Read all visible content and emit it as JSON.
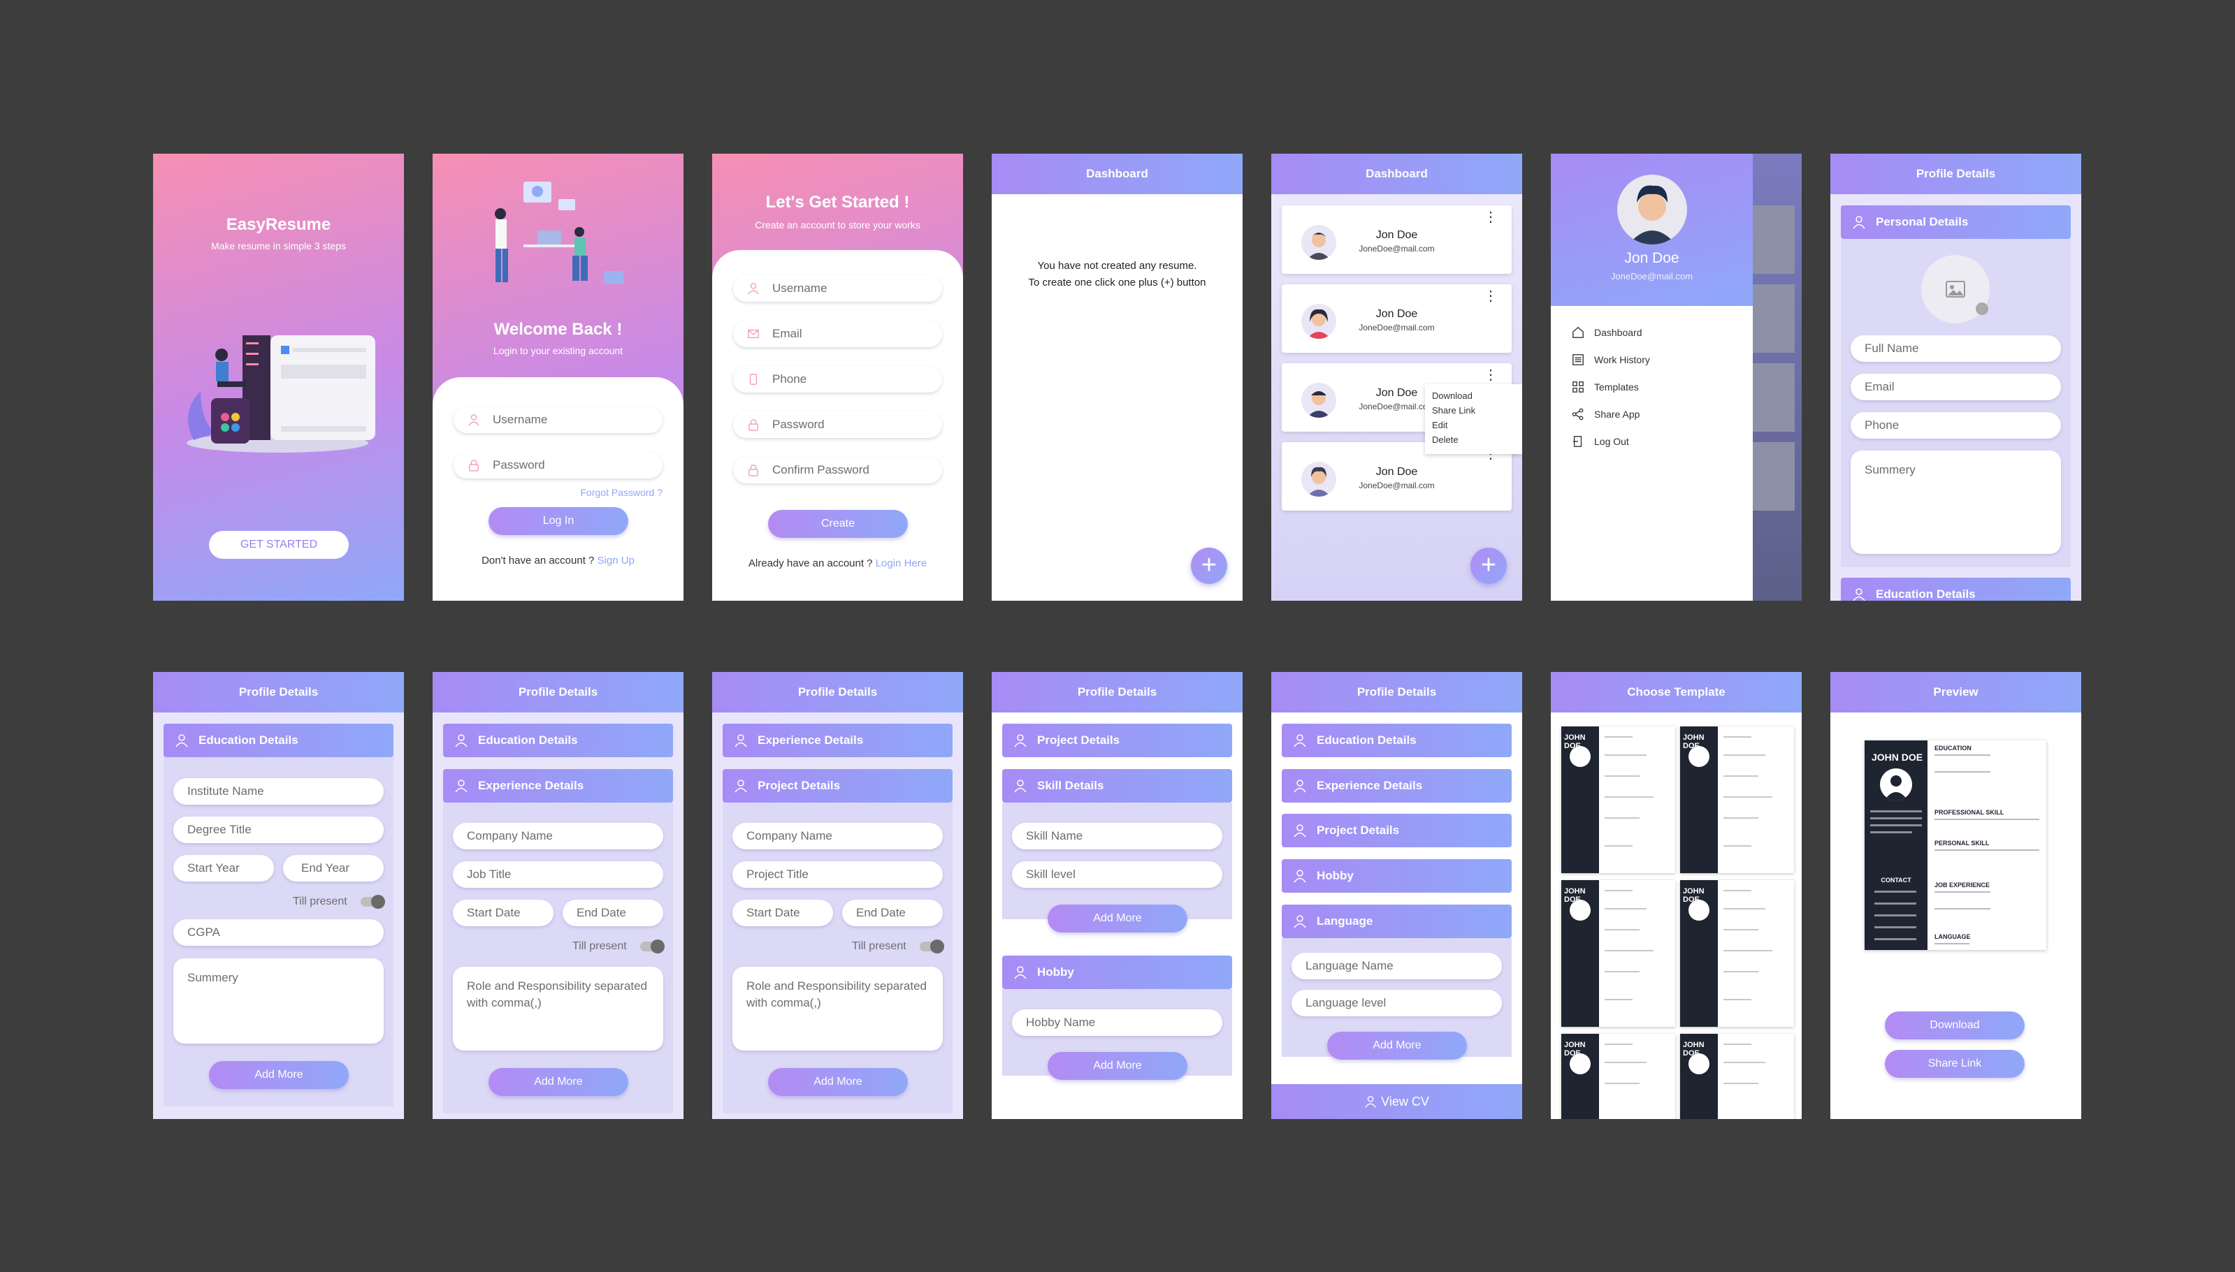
{
  "splash": {
    "title": "EasyResume",
    "subtitle": "Make resume in simple 3 steps",
    "button": "GET STARTED"
  },
  "login": {
    "title": "Welcome Back !",
    "subtitle": "Login to your existing account",
    "username_ph": "Username",
    "password_ph": "Password",
    "forgot": "Forgot Password ?",
    "button": "Log In",
    "signup_prompt": "Don't have an account ?",
    "signup_link": "Sign Up"
  },
  "register": {
    "title": "Let's Get Started !",
    "subtitle": "Create an account  to store  your works",
    "fields": [
      "Username",
      "Email",
      "Phone",
      "Password",
      "Confirm Password"
    ],
    "button": "Create",
    "login_prompt": "Already have an account ?",
    "login_link": "Login Here"
  },
  "dashboard_empty": {
    "title": "Dashboard",
    "line1": "You have not created any resume.",
    "line2": "To create one click one plus (+) button",
    "fab": "+"
  },
  "dashboard": {
    "title": "Dashboard",
    "cards": [
      {
        "name": "Jon Doe",
        "email": "JoneDoe@mail.com"
      },
      {
        "name": "Jon Doe",
        "email": "JoneDoe@mail.com"
      },
      {
        "name": "Jon Doe",
        "email": "JoneDoe@mail.com"
      },
      {
        "name": "Jon Doe",
        "email": "JoneDoe@mail.com"
      }
    ],
    "menu": [
      "Download",
      "Share Link",
      "Edit",
      "Delete"
    ],
    "fab": "+"
  },
  "drawer": {
    "name": "Jon Doe",
    "email": "JoneDoe@mail.com",
    "items": [
      "Dashboard",
      "Work History",
      "Templates",
      "Share App",
      "Log Out"
    ]
  },
  "profile_personal": {
    "title": "Profile Details",
    "section": "Personal Details",
    "fields": [
      "Full Name",
      "Email",
      "Phone"
    ],
    "summary": "Summery",
    "next_section": "Education Details"
  },
  "profile_education": {
    "title": "Profile Details",
    "section": "Education Details",
    "institute": "Institute Name",
    "degree": "Degree Title",
    "start": "Start Year",
    "end": "End Year",
    "till": "Till present",
    "cgpa": "CGPA",
    "summary": "Summery",
    "button": "Add More"
  },
  "profile_experience": {
    "title": "Profile Details",
    "section1": "Education Details",
    "section2": "Experience Details",
    "company": "Company Name",
    "job": "Job Title",
    "start": "Start Date",
    "end": "End Date",
    "till": "Till present",
    "role": "Role and Responsibility separated with comma(,)",
    "button": "Add More"
  },
  "profile_project": {
    "title": "Profile Details",
    "section1": "Experience Details",
    "section2": "Project Details",
    "company": "Company Name",
    "project": "Project Title",
    "start": "Start Date",
    "end": "End Date",
    "till": "Till present",
    "role": "Role and Responsibility separated with comma(,)",
    "button": "Add More"
  },
  "profile_skill": {
    "title": "Profile Details",
    "section1": "Project Details",
    "section2": "Skill Details",
    "skill_name": "Skill Name",
    "skill_level": "Skill level",
    "button1": "Add More",
    "section3": "Hobby",
    "hobby": "Hobby Name",
    "button2": "Add More"
  },
  "profile_language": {
    "title": "Profile Details",
    "sections": [
      "Education Details",
      "Experience Details",
      "Project Details",
      "Hobby"
    ],
    "section_lang": "Language",
    "lang_name": "Language Name",
    "lang_level": "Language level",
    "button": "Add More",
    "view_cv": "View CV"
  },
  "templates": {
    "title": "Choose Template",
    "name": "JOHN DOE"
  },
  "preview": {
    "title": "Preview",
    "name": "JOHN DOE",
    "sections": [
      "EDUCATION",
      "PROFESSIONAL SKILL",
      "PERSONAL SKILL",
      "JOB EXPERIENCE",
      "LANGUAGE"
    ],
    "contact": "CONTACT",
    "download": "Download",
    "share": "Share Link"
  },
  "colors": {
    "accent_start": "#a78bf5",
    "accent_end": "#8fa8f8",
    "pink": "#f78fb3",
    "panel": "#dcd9f7",
    "backdrop": "#3d3d3d"
  }
}
